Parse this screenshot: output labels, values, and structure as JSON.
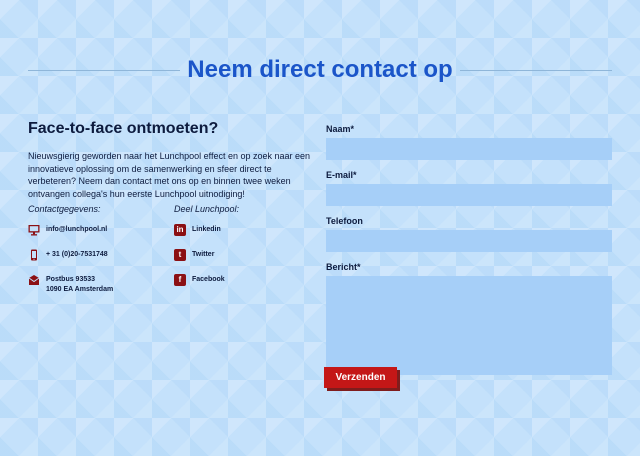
{
  "header": {
    "title": "Neem direct contact op"
  },
  "intro": {
    "heading": "Face-to-face ontmoeten?",
    "text": "Nieuwsgierig geworden naar het Lunchpool effect en op zoek naar een innovatieve oplossing om de samenwerking en sfeer direct te verbeteren? Neem dan contact met ons op en binnen twee weken ontvangen collega's hun eerste Lunchpool uitnodiging!"
  },
  "contact": {
    "title": "Contactgegevens:",
    "email": "info@lunchpool.nl",
    "phone": "+ 31 (0)20-7531748",
    "address_line1": "Postbus 93533",
    "address_line2": "1090 EA Amsterdam"
  },
  "share": {
    "title": "Deel Lunchpool:",
    "items": [
      {
        "label": "Linkedin",
        "icon": "linkedin-icon",
        "glyph": "in"
      },
      {
        "label": "Twitter",
        "icon": "twitter-icon",
        "glyph": "t"
      },
      {
        "label": "Facebook",
        "icon": "facebook-icon",
        "glyph": "f"
      }
    ]
  },
  "form": {
    "name_label": "Naam*",
    "name_value": "",
    "email_label": "E-mail*",
    "email_value": "",
    "phone_label": "Telefoon",
    "phone_value": "",
    "message_label": "Bericht*",
    "message_value": "",
    "submit_label": "Verzenden"
  },
  "colors": {
    "background": "#c4e1fb",
    "title": "#1b55c9",
    "input": "#a6cff8",
    "button": "#c41717",
    "icon": "#8b1014"
  }
}
